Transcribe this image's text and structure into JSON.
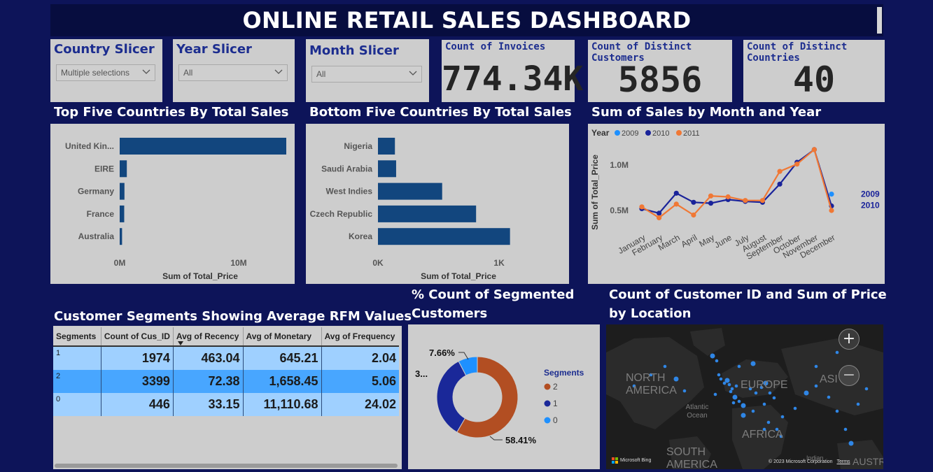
{
  "header": {
    "title": "ONLINE RETAIL SALES DASHBOARD"
  },
  "slicers": {
    "country": {
      "label": "Country Slicer",
      "value": "Multiple selections"
    },
    "year": {
      "label": "Year Slicer",
      "value": "All"
    },
    "month": {
      "label": "Month Slicer",
      "value": "All"
    }
  },
  "kpis": {
    "invoices": {
      "label": "Count of Invoices",
      "value": "774.34K"
    },
    "customers": {
      "label": "Count of Distinct Customers",
      "value": "5856"
    },
    "countries": {
      "label": "Count of Distinct Countries",
      "value": "40"
    }
  },
  "sections": {
    "top_five": "Top Five Countries By Total Sales",
    "bottom_five": "Bottom Five Countries By Total Sales",
    "monthly": "Sum of Sales by Month and Year",
    "segments_table": "Customer Segments Showing Average RFM Values",
    "donut_line1": "% Count of Segmented",
    "donut_line2": "Customers",
    "map_line1": "Count of Customer ID and Sum of Price",
    "map_line2": "by Location"
  },
  "chart_data": [
    {
      "type": "bar",
      "orientation": "horizontal",
      "categories": [
        "United Kin...",
        "EIRE",
        "Germany",
        "France",
        "Australia"
      ],
      "values": [
        14000000,
        600000,
        400000,
        380000,
        200000
      ],
      "xlabel": "Sum of Total_Price",
      "x_ticks": [
        "0M",
        "10M"
      ],
      "xlim": [
        0,
        15000000
      ],
      "color": "#12467e"
    },
    {
      "type": "bar",
      "orientation": "horizontal",
      "categories": [
        "Nigeria",
        "Saudi Arabia",
        "West Indies",
        "Czech Republic",
        "Korea"
      ],
      "values": [
        140,
        150,
        530,
        810,
        1090
      ],
      "xlabel": "Sum of Total_Price",
      "x_ticks": [
        "0K",
        "1K"
      ],
      "xlim": [
        0,
        1300
      ],
      "color": "#12467e"
    },
    {
      "type": "line",
      "legend_title": "Year",
      "categories": [
        "January",
        "February",
        "March",
        "April",
        "May",
        "June",
        "July",
        "August",
        "September",
        "October",
        "November",
        "December"
      ],
      "ylabel": "Sum of Total_Price",
      "y_ticks": [
        "0.5M",
        "1.0M"
      ],
      "ylim": [
        0.3,
        1.3
      ],
      "series": [
        {
          "name": "2009",
          "color": "#1e90ff",
          "values": [
            null,
            null,
            null,
            null,
            null,
            null,
            null,
            null,
            null,
            null,
            null,
            0.68
          ]
        },
        {
          "name": "2010",
          "color": "#1a239a",
          "values": [
            0.52,
            0.47,
            0.69,
            0.59,
            0.58,
            0.62,
            0.6,
            0.59,
            0.79,
            1.03,
            1.17,
            0.55
          ]
        },
        {
          "name": "2011",
          "color": "#f07835",
          "values": [
            0.54,
            0.42,
            0.57,
            0.45,
            0.66,
            0.65,
            0.61,
            0.61,
            0.93,
            1.01,
            1.17,
            0.5
          ]
        }
      ],
      "end_labels": [
        "2009",
        "2010"
      ]
    },
    {
      "type": "pie",
      "legend_title": "Segments",
      "series": [
        {
          "name": "2",
          "value": 58.41,
          "color": "#b24e22"
        },
        {
          "name": "1",
          "value": 33.93,
          "color": "#1a2899"
        },
        {
          "name": "0",
          "value": 7.66,
          "color": "#1e90ff"
        }
      ],
      "data_labels": [
        "58.41%",
        "3...",
        "7.66%"
      ]
    },
    {
      "type": "table",
      "columns": [
        "Segments",
        "Count of Cus_ID",
        "Avg of Recency",
        "Avg of Monetary",
        "Avg of Frequency"
      ],
      "rows": [
        [
          "1",
          "1974",
          "463.04",
          "645.21",
          "2.04"
        ],
        [
          "2",
          "3399",
          "72.38",
          "1,658.45",
          "5.06"
        ],
        [
          "0",
          "446",
          "33.15",
          "11,110.68",
          "24.02"
        ]
      ]
    }
  ],
  "map": {
    "labels": {
      "north_america": "NORTH AMERICA",
      "europe": "EUROPE",
      "asia": "ASI",
      "atlantic": "Atlantic Ocean",
      "africa": "AFRICA",
      "south_america": "SOUTH AMERICA",
      "indian": "Indian",
      "austr": "AUSTR"
    },
    "bing": "Microsoft Bing",
    "copyright": "© 2023 Microsoft Corporation",
    "terms": "Terms",
    "zoom_in": "+",
    "zoom_out": "−"
  }
}
